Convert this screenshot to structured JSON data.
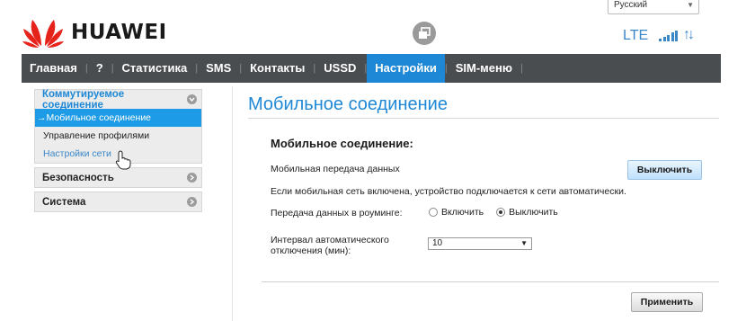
{
  "header": {
    "brand": "HUAWEI",
    "language": "Русский",
    "network_type": "LTE",
    "signal_level": 4,
    "colors": {
      "accent": "#1e88d6",
      "brand_red": "#e5231b",
      "nav_bg": "#4a4d50"
    }
  },
  "nav": {
    "items": [
      {
        "label": "Главная"
      },
      {
        "label": "?"
      },
      {
        "label": "Статистика"
      },
      {
        "label": "SMS"
      },
      {
        "label": "Контакты"
      },
      {
        "label": "USSD"
      },
      {
        "label": "Настройки",
        "active": true
      },
      {
        "label": "SIM-меню"
      }
    ]
  },
  "sidebar": {
    "groups": [
      {
        "title": "Коммутируемое соединение",
        "expanded": true,
        "items": [
          {
            "label": "→Мобильное соединение",
            "active": true
          },
          {
            "label": "Управление профилями"
          },
          {
            "label": "Настройки сети"
          }
        ]
      },
      {
        "title": "Безопасность",
        "expanded": false
      },
      {
        "title": "Система",
        "expanded": false
      }
    ]
  },
  "main": {
    "page_title": "Мобильное соединение",
    "section_title": "Мобильное соединение:",
    "mobile_data_label": "Мобильная передача данных",
    "mobile_data_button": "Выключить",
    "info_text": "Если мобильная сеть включена, устройство подключается к сети автоматически.",
    "roaming_label": "Передача данных в роуминге:",
    "roaming_options": [
      {
        "label": "Включить",
        "checked": false
      },
      {
        "label": "Выключить",
        "checked": true
      }
    ],
    "auto_disconnect_label_line1": "Интервал автоматического",
    "auto_disconnect_label_line2": "отключения (мин):",
    "auto_disconnect_value": "10",
    "apply_button": "Применить"
  }
}
